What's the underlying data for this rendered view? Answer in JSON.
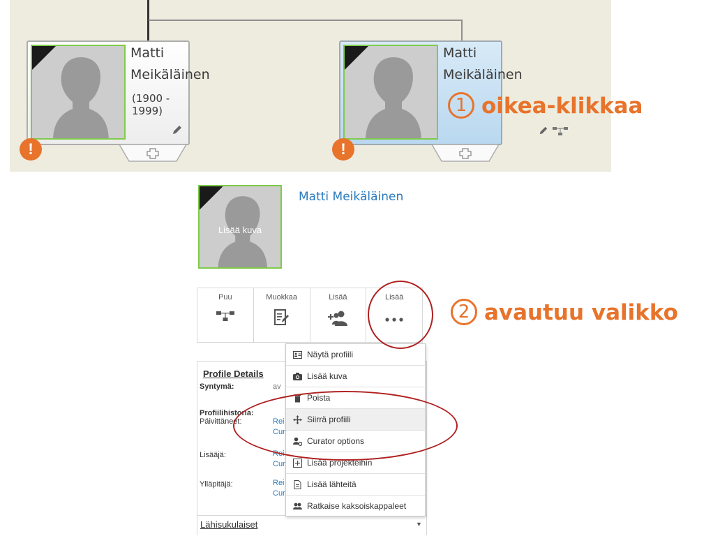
{
  "tree": {
    "cards": [
      {
        "first_name": "Matti",
        "last_name": "Meikäläinen",
        "years": "(1900 - 1999)",
        "selected": false
      },
      {
        "first_name": "Matti",
        "last_name": "Meikäläinen",
        "years": "",
        "selected": true
      }
    ],
    "alert_glyph": "!"
  },
  "annotations": {
    "step1_number": "1",
    "step1_text": "oikea-klikkaa",
    "step2_number": "2",
    "step2_text": "avautuu valikko",
    "color": "#e8732b"
  },
  "profile": {
    "name": "Matti Meikäläinen",
    "add_photo_label": "Lisää kuva"
  },
  "actions": [
    {
      "label": "Puu",
      "icon": "tree-icon"
    },
    {
      "label": "Muokkaa",
      "icon": "edit-icon"
    },
    {
      "label": "Lisää",
      "icon": "add-person-icon"
    },
    {
      "label": "Lisää",
      "icon": "more-dots-icon"
    }
  ],
  "details": {
    "title": "Profile Details",
    "born_label": "Syntymä:",
    "born_value": "av",
    "history_label": "Profiilihistoria:",
    "updated_label": "Päivittäneet:",
    "updated_links": [
      "Rei",
      "Cur"
    ],
    "added_label": "Lisääjä:",
    "added_links": [
      "Rei",
      "Cur"
    ],
    "maintainer_label": "Ylläpitäjä:",
    "maintainer_links": [
      "Rei",
      "Cur"
    ],
    "relatives_label": "Lähisukulaiset"
  },
  "menu": {
    "items": [
      {
        "label": "Näytä profiili",
        "icon": "profile-card-icon"
      },
      {
        "label": "Lisää kuva",
        "icon": "camera-icon"
      },
      {
        "label": "Poista",
        "icon": "trash-icon"
      },
      {
        "label": "Siirrä profiili",
        "icon": "move-arrows-icon"
      },
      {
        "label": "Curator options",
        "icon": "curator-icon"
      },
      {
        "label": "Lisää projekteihin",
        "icon": "plus-box-icon"
      },
      {
        "label": "Lisää lähteitä",
        "icon": "document-icon"
      },
      {
        "label": "Ratkaise kaksoiskappaleet",
        "icon": "merge-people-icon"
      }
    ]
  }
}
